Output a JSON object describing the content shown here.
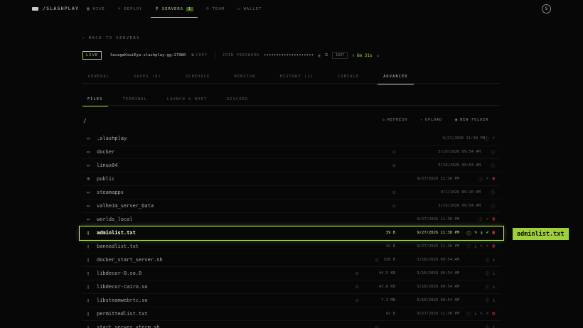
{
  "brand": {
    "name": "/SLASHPLAY"
  },
  "nav": [
    {
      "label": "HIVE",
      "icon": "▦",
      "active": false
    },
    {
      "label": "DEPLOY",
      "icon": "+",
      "active": false
    },
    {
      "label": "SERVERS",
      "icon": "⚲",
      "active": true,
      "badge": "1"
    },
    {
      "label": "TEAM",
      "icon": "☺",
      "active": false
    },
    {
      "label": "WALLET",
      "icon": "▭",
      "active": false
    }
  ],
  "avatar": "S",
  "back_label": "BACK TO SERVERS",
  "server": {
    "status": "LIVE",
    "host": "SavageKiwiEye.slashplay.gg:27980",
    "copy_label": "COPY",
    "password_label": "JOIN PASSWORD",
    "password": "••••••••••••••••••••",
    "port": "1037",
    "uptime": "6m 31s"
  },
  "tabs": [
    "GENERAL",
    "SAVES (8)",
    "SCHEDULE",
    "MONITOR",
    "HISTORY (1)",
    "CONSOLE",
    "ADVANCED"
  ],
  "subtabs": [
    "FILES",
    "TERMINAL",
    "LAUNCH & BOOT",
    "DISCORD"
  ],
  "path": "/",
  "toolbar": {
    "refresh": "REFRESH",
    "upload": "UPLOAD",
    "new_folder": "NEW FOLDER"
  },
  "files": [
    {
      "name": ".slashplay",
      "type": "folder",
      "size": "",
      "date": "9/27/2026 11:38 PM",
      "locked": false
    },
    {
      "name": "docker",
      "type": "folder",
      "size": "",
      "date": "5/16/2026 09:54 AM",
      "locked": true
    },
    {
      "name": "linux64",
      "type": "folder",
      "size": "",
      "date": "5/16/2026 09:54 AM",
      "locked": true
    },
    {
      "name": "public",
      "type": "globe",
      "size": "",
      "date": "9/27/2026 11:38 PM",
      "locked": false
    },
    {
      "name": "steamapps",
      "type": "folder",
      "size": "",
      "date": "9/1/2026 09:10 AM",
      "locked": true
    },
    {
      "name": "valheim_server_Data",
      "type": "folder",
      "size": "",
      "date": "5/16/2026 09:54 AM",
      "locked": true
    },
    {
      "name": "worlds_local",
      "type": "folder",
      "size": "",
      "date": "9/27/2026 11:38 PM",
      "locked": false
    },
    {
      "name": "adminlist.txt",
      "type": "file",
      "size": "39 B",
      "date": "9/27/2026 11:38 PM",
      "locked": false,
      "selected": true
    },
    {
      "name": "bannedlist.txt",
      "type": "file",
      "size": "42 B",
      "date": "9/27/2026 11:38 PM",
      "locked": false
    },
    {
      "name": "docker_start_server.sh",
      "type": "file",
      "size": "526 B",
      "date": "5/16/2026 09:54 AM",
      "locked": true
    },
    {
      "name": "libdecor-0.so.0",
      "type": "file",
      "size": "44.5 KB",
      "date": "5/16/2026 09:54 AM",
      "locked": true
    },
    {
      "name": "libdecor-cairo.so",
      "type": "file",
      "size": "43.8 KB",
      "date": "5/16/2026 09:54 AM",
      "locked": true
    },
    {
      "name": "libsteamwebrtc.so",
      "type": "file",
      "size": "7.3 MB",
      "date": "5/16/2026 09:54 AM",
      "locked": true
    },
    {
      "name": "permittedlist.txt",
      "type": "file",
      "size": "42 B",
      "date": "9/27/2026 11:38 PM",
      "locked": false
    },
    {
      "name": "start_server_xterm.sh",
      "type": "file",
      "size": "",
      "date": "",
      "locked": true
    }
  ],
  "tooltip": "adminlist.txt"
}
